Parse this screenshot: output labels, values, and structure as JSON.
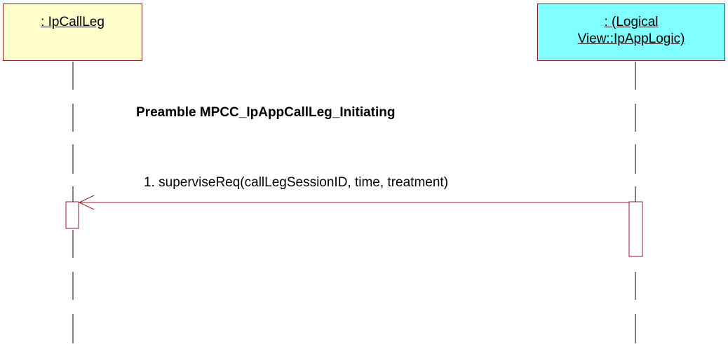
{
  "lifelines": {
    "left": {
      "name": " : IpCallLeg",
      "fill": "#ffffcc"
    },
    "right": {
      "name": " : (Logical \nView::IpAppLogic)",
      "fill": "#80ffff"
    }
  },
  "note": {
    "text": "Preamble MPCC_IpAppCallLeg_Initiating"
  },
  "messages": [
    {
      "label": "1. superviseReq(callLegSessionID, time, treatment)",
      "from": "right",
      "to": "left"
    }
  ],
  "colors": {
    "border": "#8b1c2c",
    "line": "#000000"
  }
}
